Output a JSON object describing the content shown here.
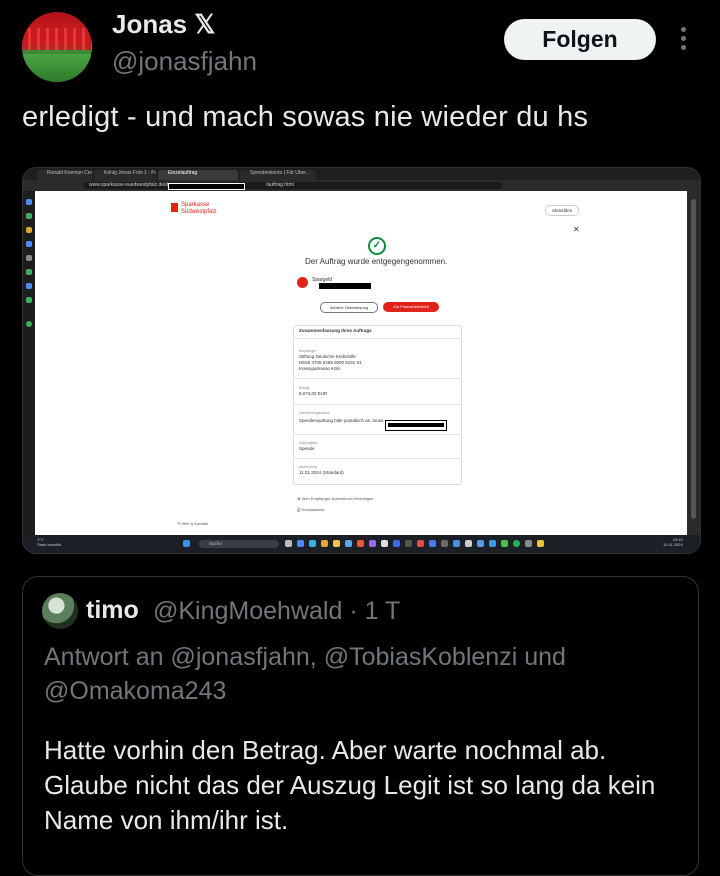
{
  "author": {
    "name": "Jonas 𝕏",
    "handle": "@jonasfjahn",
    "follow_label": "Folgen"
  },
  "tweet": {
    "text": "erledigt - und mach sowas nie wieder du hs"
  },
  "media": {
    "tabs": [
      {
        "label": "Ronald Koeman Centurion · X",
        "active": false
      },
      {
        "label": "König Jonas Folo 1 - Playlis",
        "active": false
      },
      {
        "label": "Einzelauftrag",
        "active": true
      },
      {
        "label": "Spendenkonto | Für Über...",
        "active": false
      }
    ],
    "url": "www.sparkasse-suedwestpfalz.de/de",
    "url_suffix": "/auftrag.html",
    "bank_name_line1": "Sparkasse",
    "bank_name_line2": "Südwestpfalz",
    "logout_label": "Abmelden",
    "confirmation": "Der Auftrag wurde entgegengenommen.",
    "account_label": "Spargeld",
    "btn_more": "Weitere Überweisung",
    "btn_finance": "Zur Finanzübersicht",
    "summary_title": "Zusammenfassung Ihres Auftrags",
    "recipient_label": "Empfänger",
    "recipient_name": "Stiftung Deutsche Krebshilfe",
    "recipient_iban": "DE65 3705 0299 0000 9191 91",
    "recipient_bank": "Kreissparkasse Köln",
    "amount_label": "Betrag",
    "amount_value": "8.073,00 EUR",
    "purpose_label": "Verwendungszweck",
    "purpose_value": "Spendenquittung bitte postalisch an Jonas",
    "payment_type_label": "Zahlungsart",
    "payment_type_value": "Spende",
    "execution_label": "Ausführung",
    "execution_value": "11.01.2024 (Standard)",
    "link_save_recipient": "Zum Empfänger-Adressbuch hinzufügen",
    "link_print": "Druckansicht",
    "help_label": "Hilfe & Kontakt",
    "taskbar_search": "Suche",
    "weather_temp": "1°C",
    "weather_desc": "Stark bewölkt",
    "clock_time": "19:15",
    "clock_date": "11.01.2024"
  },
  "quote": {
    "name": "timo",
    "meta": "@KingMoehwald · 1 T",
    "reply_to": "Antwort an @jonasfjahn, @TobiasKoblenzi und @Omakoma243",
    "text": "Hatte vorhin den Betrag. Aber warte nochmal ab. Glaube nicht das der Auszug Legit ist so lang da kein Name von ihm/ihr ist."
  },
  "colors": {
    "background": "#000000",
    "text_primary": "#e7e9ea",
    "text_secondary": "#71767b",
    "follow_bg": "#eff3f4",
    "sparkasse_red": "#e2231a",
    "success_green": "#0b8a3e"
  },
  "icons": [
    "more-icon",
    "verified-x-icon",
    "check-circle-icon",
    "sparkasse-logo-icon"
  ]
}
